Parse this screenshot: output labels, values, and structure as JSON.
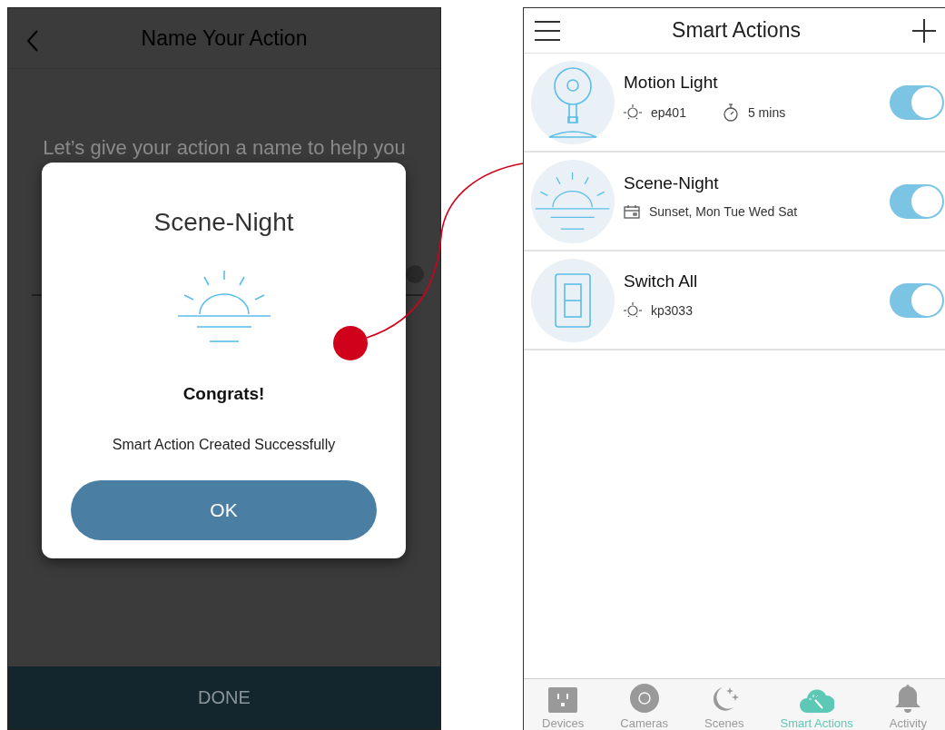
{
  "left_screen": {
    "title": "Name Your Action",
    "prompt": "Let’s give your action a name to help you",
    "done_button": "DONE",
    "dimmed": true
  },
  "dialog": {
    "title": "Scene-Night",
    "heading": "Congrats!",
    "message": "Smart Action Created Successfully",
    "ok_button": "OK"
  },
  "right_screen": {
    "title": "Smart Actions",
    "actions": [
      {
        "name": "Motion Light",
        "kind": "camera",
        "on": true,
        "details": [
          {
            "kind": "device",
            "text": "ep401"
          },
          {
            "kind": "timer",
            "text": "5 mins"
          }
        ]
      },
      {
        "name": "Scene-Night",
        "kind": "sunset",
        "on": true,
        "details": [
          {
            "kind": "schedule",
            "text": "Sunset, Mon Tue Wed Sat"
          }
        ]
      },
      {
        "name": "Switch All",
        "kind": "switch",
        "on": true,
        "details": [
          {
            "kind": "device",
            "text": "kp3033"
          }
        ]
      }
    ],
    "tabs": [
      {
        "label": "Devices",
        "kind": "outlet",
        "selected": false
      },
      {
        "label": "Cameras",
        "kind": "camera",
        "selected": false
      },
      {
        "label": "Scenes",
        "kind": "moon",
        "selected": false
      },
      {
        "label": "Smart Actions",
        "kind": "cloud",
        "selected": true
      },
      {
        "label": "Activity",
        "kind": "bell",
        "selected": false
      }
    ]
  }
}
